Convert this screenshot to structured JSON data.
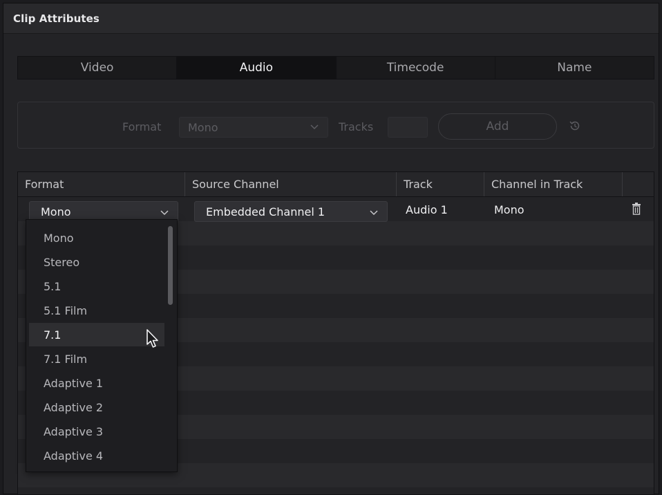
{
  "window": {
    "title": "Clip Attributes"
  },
  "tabs": [
    {
      "label": "Video",
      "active": false
    },
    {
      "label": "Audio",
      "active": true
    },
    {
      "label": "Timecode",
      "active": false
    },
    {
      "label": "Name",
      "active": false
    }
  ],
  "add_panel": {
    "format_label": "Format",
    "format_value": "Mono",
    "tracks_label": "Tracks",
    "tracks_value": "",
    "add_label": "Add",
    "enabled": false
  },
  "table": {
    "headers": [
      "Format",
      "Source Channel",
      "Track",
      "Channel in Track"
    ],
    "rows": [
      {
        "format": "Mono",
        "source_channel": "Embedded Channel 1",
        "track": "Audio 1",
        "channel_in_track": "Mono"
      }
    ]
  },
  "format_dropdown": {
    "options": [
      "Mono",
      "Stereo",
      "5.1",
      "5.1 Film",
      "7.1",
      "7.1 Film",
      "Adaptive 1",
      "Adaptive 2",
      "Adaptive 3",
      "Adaptive 4"
    ],
    "hovered": "7.1"
  },
  "icons": {
    "chevron": "chevron-down-icon",
    "reset": "reset-icon",
    "trash": "trash-icon",
    "cursor": "mouse-pointer-icon"
  },
  "colors": {
    "background": "#232326",
    "active_tab": "#111113",
    "text": "#f0f0f2",
    "disabled_text": "#5c5c61"
  }
}
